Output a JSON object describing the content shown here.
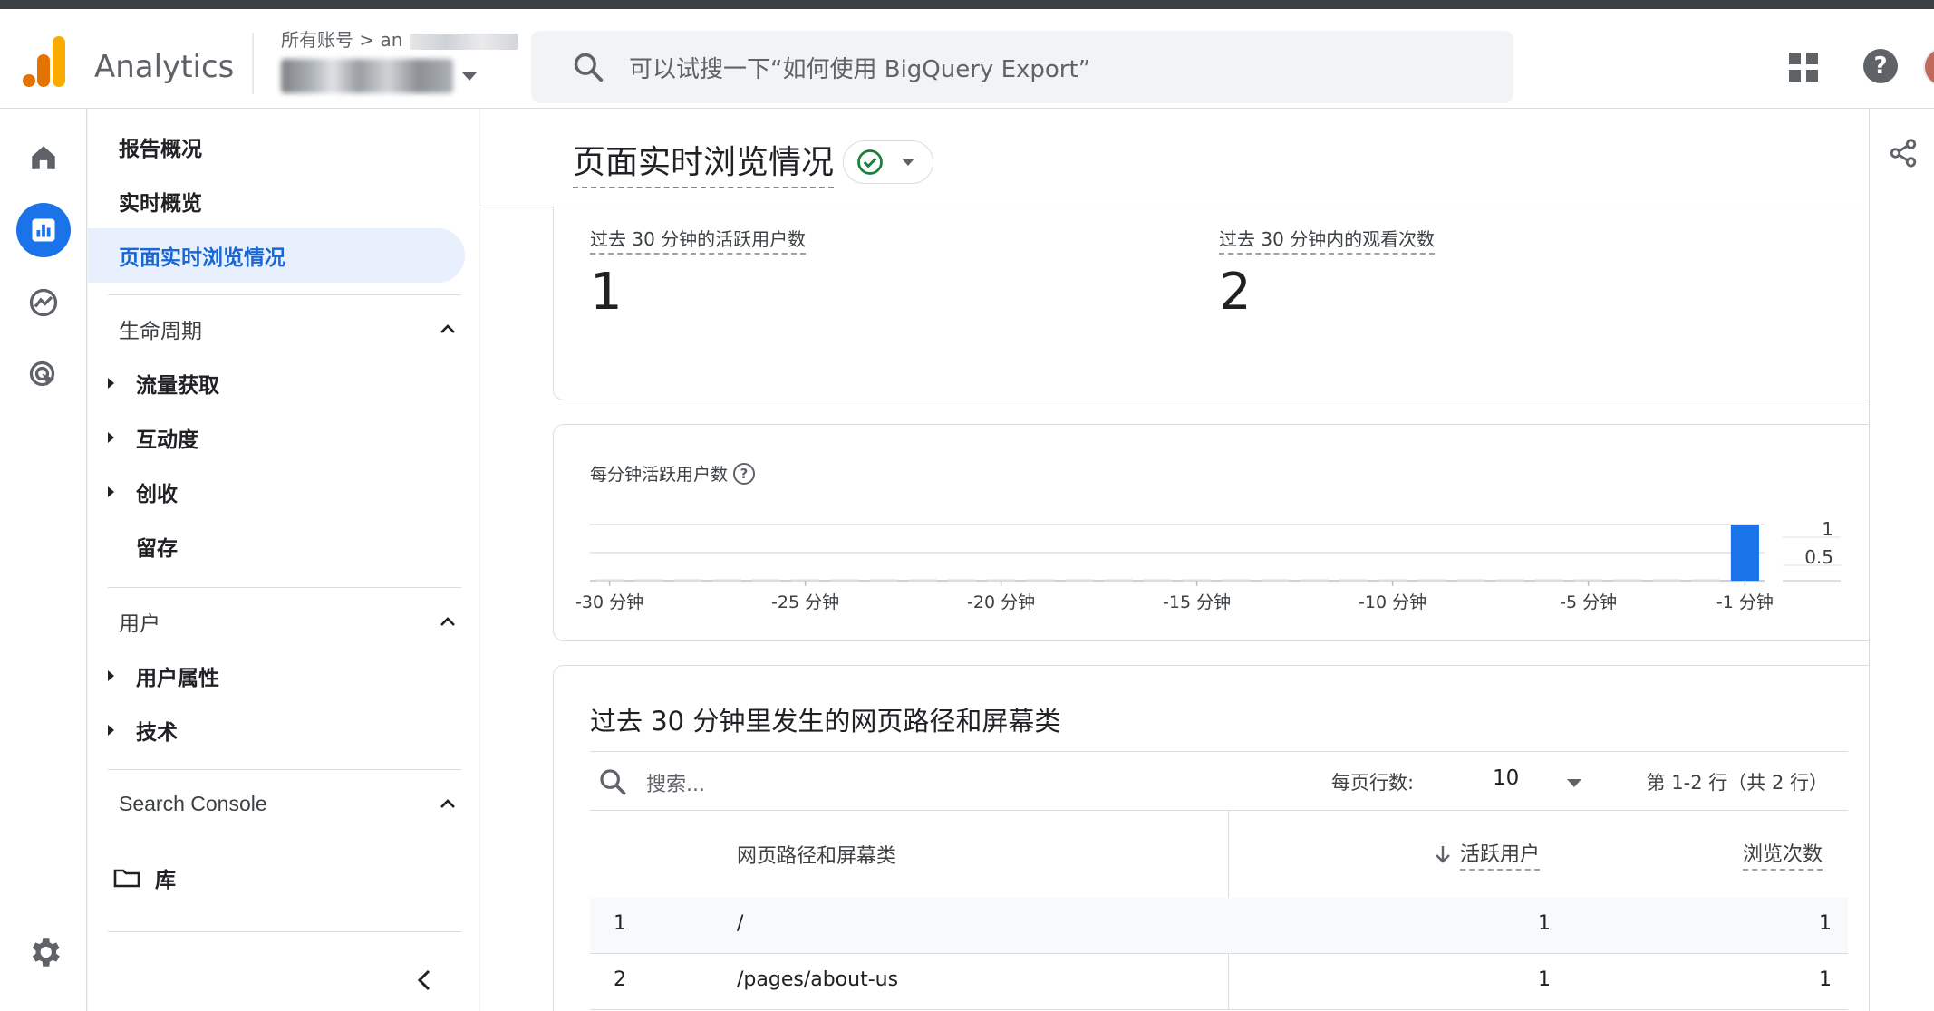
{
  "header": {
    "app_name": "Analytics",
    "account_crumb": "所有账号 >",
    "account_name_partial": "an",
    "search_placeholder": "可以试搜一下“如何使用 BigQuery Export”"
  },
  "colors": {
    "accent": "#1a73e8",
    "active_nav_bg": "#e8f0fe",
    "bar": "#1a73e8",
    "logo_orange": "#f9ab00",
    "logo_dark_orange": "#e37400",
    "status_green": "#188038"
  },
  "rail": {
    "icons": [
      "home-icon",
      "reports-icon",
      "explore-icon",
      "advertising-icon"
    ],
    "settings_icon": "gear-icon"
  },
  "sidenav": {
    "items": [
      {
        "label": "报告概况"
      },
      {
        "label": "实时概览"
      },
      {
        "label": "页面实时浏览情况",
        "active": true
      }
    ],
    "lifecycle": {
      "title": "生命周期",
      "items": [
        "流量获取",
        "互动度",
        "创收",
        "留存"
      ]
    },
    "user": {
      "title": "用户",
      "items": [
        "用户属性",
        "技术"
      ]
    },
    "search_console": {
      "title": "Search Console"
    },
    "library": {
      "label": "库"
    }
  },
  "page": {
    "title": "页面实时浏览情况"
  },
  "metrics": [
    {
      "label": "过去 30 分钟的活跃用户数",
      "value": "1"
    },
    {
      "label": "过去 30 分钟内的观看次数",
      "value": "2"
    }
  ],
  "chart_data": {
    "type": "bar",
    "title": "每分钟活跃用户数",
    "x": [
      -30,
      -29,
      -28,
      -27,
      -26,
      -25,
      -24,
      -23,
      -22,
      -21,
      -20,
      -19,
      -18,
      -17,
      -16,
      -15,
      -14,
      -13,
      -12,
      -11,
      -10,
      -9,
      -8,
      -7,
      -6,
      -5,
      -4,
      -3,
      -2,
      -1
    ],
    "values": [
      0,
      0,
      0,
      0,
      0,
      0,
      0,
      0,
      0,
      0,
      0,
      0,
      0,
      0,
      0,
      0,
      0,
      0,
      0,
      0,
      0,
      0,
      0,
      0,
      0,
      0,
      0,
      0,
      0,
      1
    ],
    "x_tick_labels": [
      "-30 分钟",
      "-25 分钟",
      "-20 分钟",
      "-15 分钟",
      "-10 分钟",
      "-5 分钟",
      "-1 分钟"
    ],
    "x_tick_values": [
      -30,
      -25,
      -20,
      -15,
      -10,
      -5,
      -1
    ],
    "y_tick_labels": [
      "1",
      "0.5"
    ],
    "ylim": [
      0,
      1
    ],
    "grid": true
  },
  "table": {
    "title": "过去 30 分钟里发生的网页路径和屏幕类",
    "search_placeholder": "搜索...",
    "rows_per_page_label": "每页行数:",
    "rows_per_page_value": "10",
    "page_info": "第 1-2 行（共 2 行）",
    "columns": [
      "网页路径和屏幕类",
      "活跃用户",
      "浏览次数"
    ],
    "rows": [
      {
        "index": "1",
        "path": "/",
        "active_users": "1",
        "views": "1"
      },
      {
        "index": "2",
        "path": "/pages/about-us",
        "active_users": "1",
        "views": "1"
      }
    ]
  }
}
